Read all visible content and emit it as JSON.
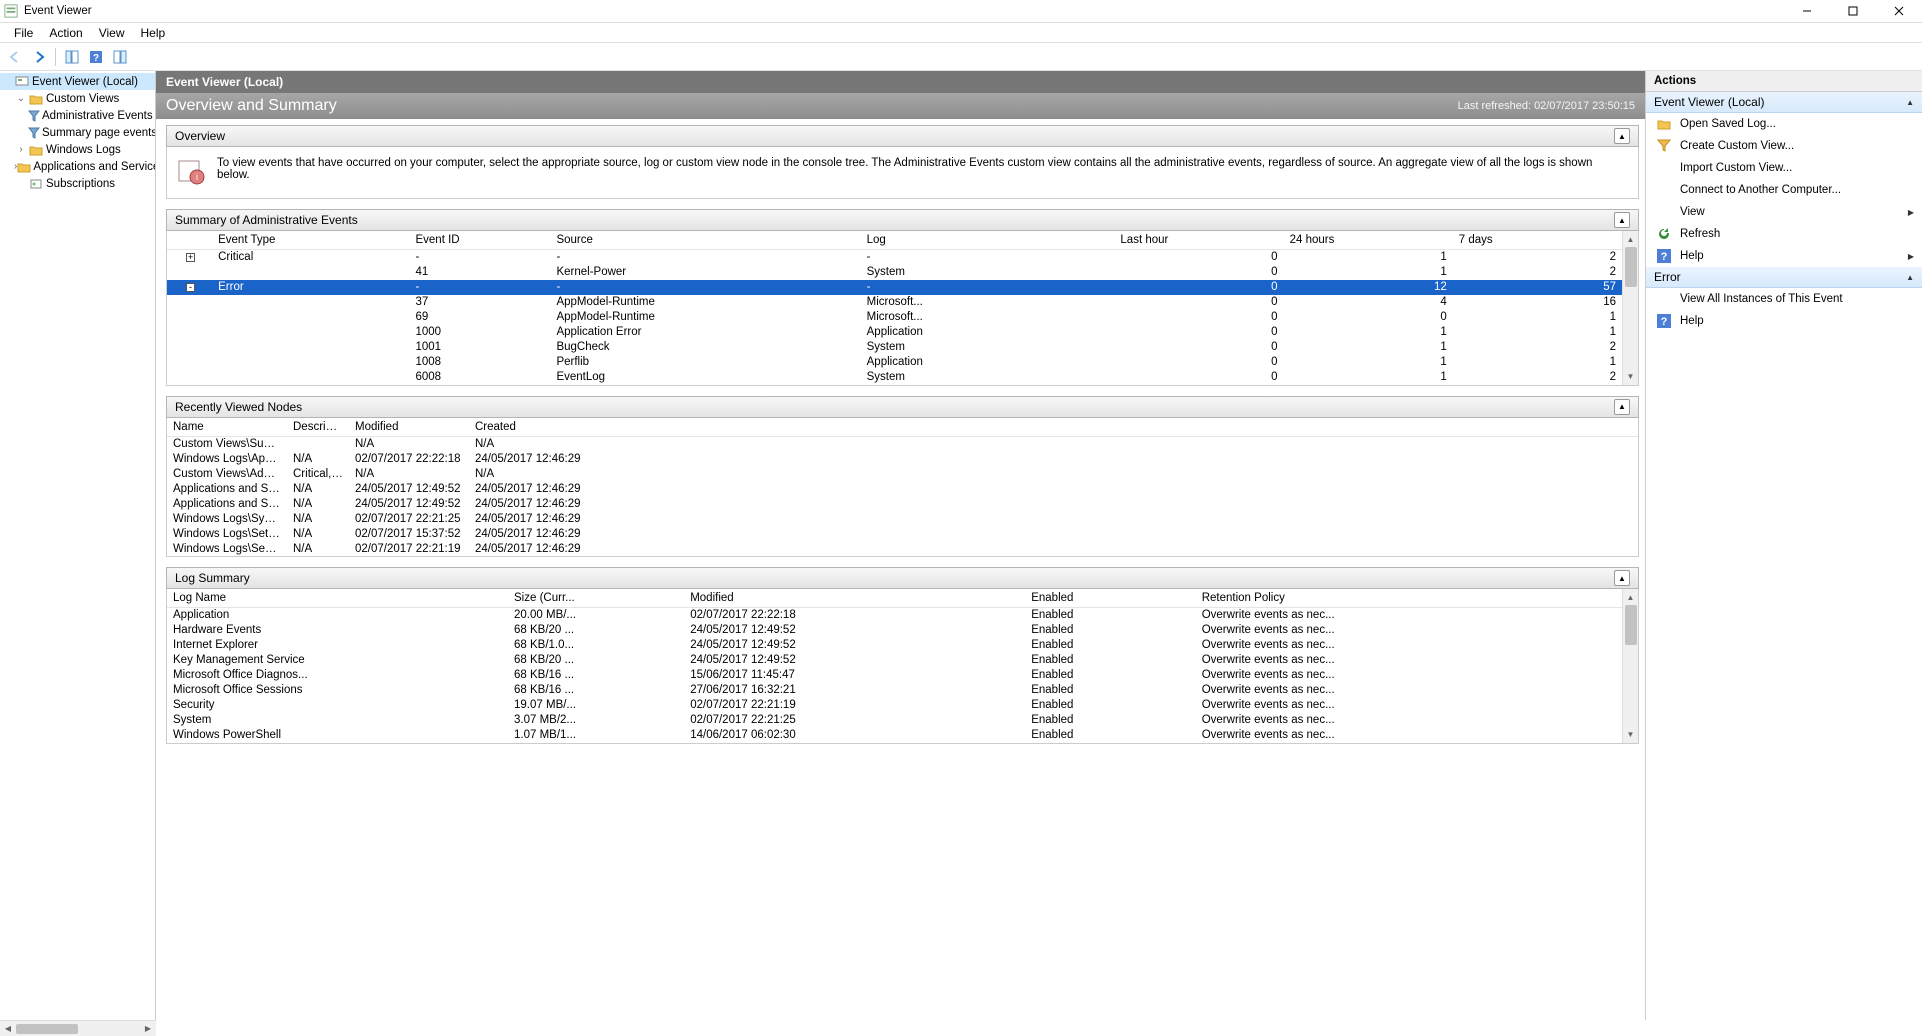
{
  "window": {
    "title": "Event Viewer",
    "menus": [
      "File",
      "Action",
      "View",
      "Help"
    ]
  },
  "tree": {
    "root": "Event Viewer (Local)",
    "custom_views": "Custom Views",
    "admin_events": "Administrative Events",
    "summary_events": "Summary page events",
    "win_logs": "Windows Logs",
    "app_svc": "Applications and Services Lo",
    "subs": "Subscriptions"
  },
  "center": {
    "local_header": "Event Viewer (Local)",
    "ovw_title": "Overview and Summary",
    "last_refreshed_label": "Last refreshed:",
    "last_refreshed_value": "02/07/2017 23:50:15",
    "overview_section": "Overview",
    "overview_text": "To view events that have occurred on your computer, select the appropriate source, log or custom view node in the console tree. The Administrative Events custom view contains all the administrative events, regardless of source. An aggregate view of all the logs is shown below.",
    "summary_section": "Summary of Administrative Events",
    "summary_headers": [
      "Event Type",
      "Event ID",
      "Source",
      "Log",
      "Last hour",
      "24 hours",
      "7 days"
    ],
    "summary_rows": [
      {
        "toggle": "+",
        "type": "Critical",
        "id": "-",
        "src": "-",
        "log": "-",
        "lh": "0",
        "d24": "1",
        "d7": "2",
        "sel": false,
        "child": false
      },
      {
        "toggle": "",
        "type": "",
        "id": "41",
        "src": "Kernel-Power",
        "log": "System",
        "lh": "0",
        "d24": "1",
        "d7": "2",
        "sel": false,
        "child": true
      },
      {
        "toggle": "-",
        "type": "Error",
        "id": "-",
        "src": "-",
        "log": "-",
        "lh": "0",
        "d24": "12",
        "d7": "57",
        "sel": true,
        "child": false
      },
      {
        "toggle": "",
        "type": "",
        "id": "37",
        "src": "AppModel-Runtime",
        "log": "Microsoft...",
        "lh": "0",
        "d24": "4",
        "d7": "16",
        "sel": false,
        "child": true
      },
      {
        "toggle": "",
        "type": "",
        "id": "69",
        "src": "AppModel-Runtime",
        "log": "Microsoft...",
        "lh": "0",
        "d24": "0",
        "d7": "1",
        "sel": false,
        "child": true
      },
      {
        "toggle": "",
        "type": "",
        "id": "1000",
        "src": "Application Error",
        "log": "Application",
        "lh": "0",
        "d24": "1",
        "d7": "1",
        "sel": false,
        "child": true
      },
      {
        "toggle": "",
        "type": "",
        "id": "1001",
        "src": "BugCheck",
        "log": "System",
        "lh": "0",
        "d24": "1",
        "d7": "2",
        "sel": false,
        "child": true
      },
      {
        "toggle": "",
        "type": "",
        "id": "1008",
        "src": "Perflib",
        "log": "Application",
        "lh": "0",
        "d24": "1",
        "d7": "1",
        "sel": false,
        "child": true
      },
      {
        "toggle": "",
        "type": "",
        "id": "6008",
        "src": "EventLog",
        "log": "System",
        "lh": "0",
        "d24": "1",
        "d7": "2",
        "sel": false,
        "child": true
      }
    ],
    "recent_section": "Recently Viewed Nodes",
    "recent_headers": [
      "Name",
      "Description",
      "Modified",
      "Created"
    ],
    "recent_rows": [
      {
        "n": "Custom Views\\Summary...",
        "d": "",
        "m": "N/A",
        "c": "N/A"
      },
      {
        "n": "Windows Logs\\Applicati...",
        "d": "N/A",
        "m": "02/07/2017 22:22:18",
        "c": "24/05/2017 12:46:29"
      },
      {
        "n": "Custom Views\\Administr...",
        "d": "Critical, Er...",
        "m": "N/A",
        "c": "N/A"
      },
      {
        "n": "Applications and Service...",
        "d": "N/A",
        "m": "24/05/2017 12:49:52",
        "c": "24/05/2017 12:46:29"
      },
      {
        "n": "Applications and Service...",
        "d": "N/A",
        "m": "24/05/2017 12:49:52",
        "c": "24/05/2017 12:46:29"
      },
      {
        "n": "Windows Logs\\System",
        "d": "N/A",
        "m": "02/07/2017 22:21:25",
        "c": "24/05/2017 12:46:29"
      },
      {
        "n": "Windows Logs\\Setup",
        "d": "N/A",
        "m": "02/07/2017 15:37:52",
        "c": "24/05/2017 12:46:29"
      },
      {
        "n": "Windows Logs\\Security",
        "d": "N/A",
        "m": "02/07/2017 22:21:19",
        "c": "24/05/2017 12:46:29"
      }
    ],
    "log_section": "Log Summary",
    "log_headers": [
      "Log Name",
      "Size (Curr...",
      "Modified",
      "Enabled",
      "Retention Policy"
    ],
    "log_rows": [
      {
        "n": "Application",
        "s": "20.00 MB/...",
        "m": "02/07/2017 22:22:18",
        "e": "Enabled",
        "r": "Overwrite events as nec..."
      },
      {
        "n": "Hardware Events",
        "s": "68 KB/20 ...",
        "m": "24/05/2017 12:49:52",
        "e": "Enabled",
        "r": "Overwrite events as nec..."
      },
      {
        "n": "Internet Explorer",
        "s": "68 KB/1.0...",
        "m": "24/05/2017 12:49:52",
        "e": "Enabled",
        "r": "Overwrite events as nec..."
      },
      {
        "n": "Key Management Service",
        "s": "68 KB/20 ...",
        "m": "24/05/2017 12:49:52",
        "e": "Enabled",
        "r": "Overwrite events as nec..."
      },
      {
        "n": "Microsoft Office Diagnos...",
        "s": "68 KB/16 ...",
        "m": "15/06/2017 11:45:47",
        "e": "Enabled",
        "r": "Overwrite events as nec..."
      },
      {
        "n": "Microsoft Office Sessions",
        "s": "68 KB/16 ...",
        "m": "27/06/2017 16:32:21",
        "e": "Enabled",
        "r": "Overwrite events as nec..."
      },
      {
        "n": "Security",
        "s": "19.07 MB/...",
        "m": "02/07/2017 22:21:19",
        "e": "Enabled",
        "r": "Overwrite events as nec..."
      },
      {
        "n": "System",
        "s": "3.07 MB/2...",
        "m": "02/07/2017 22:21:25",
        "e": "Enabled",
        "r": "Overwrite events as nec..."
      },
      {
        "n": "Windows PowerShell",
        "s": "1.07 MB/1...",
        "m": "14/06/2017 06:02:30",
        "e": "Enabled",
        "r": "Overwrite events as nec..."
      }
    ]
  },
  "actions": {
    "pane_title": "Actions",
    "sub1": "Event Viewer (Local)",
    "items1": [
      {
        "icon": "folder-open",
        "label": "Open Saved Log...",
        "chev": false
      },
      {
        "icon": "filter",
        "label": "Create Custom View...",
        "chev": false
      },
      {
        "icon": "blank",
        "label": "Import Custom View...",
        "chev": false
      },
      {
        "icon": "blank",
        "label": "Connect to Another Computer...",
        "chev": false
      },
      {
        "icon": "blank",
        "label": "View",
        "chev": true
      },
      {
        "icon": "refresh",
        "label": "Refresh",
        "chev": false
      },
      {
        "icon": "help",
        "label": "Help",
        "chev": true
      }
    ],
    "sub2": "Error",
    "items2": [
      {
        "icon": "blank",
        "label": "View All Instances of This Event",
        "chev": false
      },
      {
        "icon": "help",
        "label": "Help",
        "chev": false
      }
    ]
  }
}
